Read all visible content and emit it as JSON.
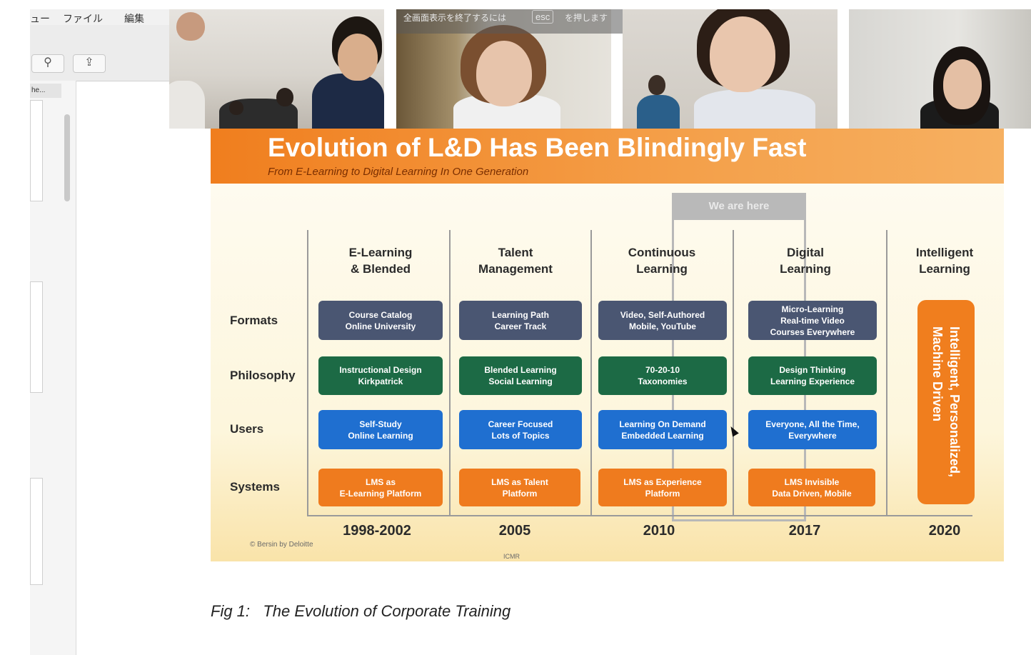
{
  "app": {
    "menu_items": [
      "ュー",
      "ファイル",
      "編集"
    ],
    "toolbar_icons": [
      "zoom-in-icon",
      "share-icon"
    ],
    "sidebar_tab_label": "he..."
  },
  "fullscreen_banner": {
    "prefix": "全画面表示を終了するには",
    "key": "esc",
    "suffix": "を押します"
  },
  "slide": {
    "title": "Evolution of L&D Has Been Blindingly Fast",
    "subtitle": "From E-Learning to Digital Learning In One Generation",
    "we_are_here": "We are here",
    "columns": [
      {
        "header": "E-Learning\n& Blended",
        "year": "1998-2002"
      },
      {
        "header": "Talent\nManagement",
        "year": "2005"
      },
      {
        "header": "Continuous\nLearning",
        "year": "2010"
      },
      {
        "header": "Digital\nLearning",
        "year": "2017"
      },
      {
        "header": "Intelligent\nLearning",
        "year": "2020"
      }
    ],
    "rows": [
      {
        "label": "Formats",
        "cells": [
          "Course Catalog\nOnline University",
          "Learning Path\nCareer Track",
          "Video, Self-Authored\nMobile, YouTube",
          "Micro-Learning\nReal-time Video\nCourses Everywhere"
        ]
      },
      {
        "label": "Philosophy",
        "cells": [
          "Instructional Design\nKirkpatrick",
          "Blended Learning\nSocial Learning",
          "70-20-10\nTaxonomies",
          "Design Thinking\nLearning Experience"
        ]
      },
      {
        "label": "Users",
        "cells": [
          "Self-Study\nOnline Learning",
          "Career Focused\nLots of Topics",
          "Learning On Demand\nEmbedded Learning",
          "Everyone, All the Time,\nEverywhere"
        ]
      },
      {
        "label": "Systems",
        "cells": [
          "LMS as\nE-Learning Platform",
          "LMS as Talent\nPlatform",
          "LMS as Experience\nPlatform",
          "LMS Invisible\nData Driven, Mobile"
        ]
      }
    ],
    "intelligent_box": "Intelligent, Personalized,\nMachine Driven",
    "copyright": "© Bersin by Deloitte",
    "logo_text": "ICMR"
  },
  "colors": {
    "formats": "#4a5672",
    "philosophy": "#1c6a45",
    "users": "#1f6fd0",
    "systems": "#ef7b1e",
    "banner": "#f07e1e"
  },
  "caption": "Fig 1:   The Evolution of Corporate Training"
}
